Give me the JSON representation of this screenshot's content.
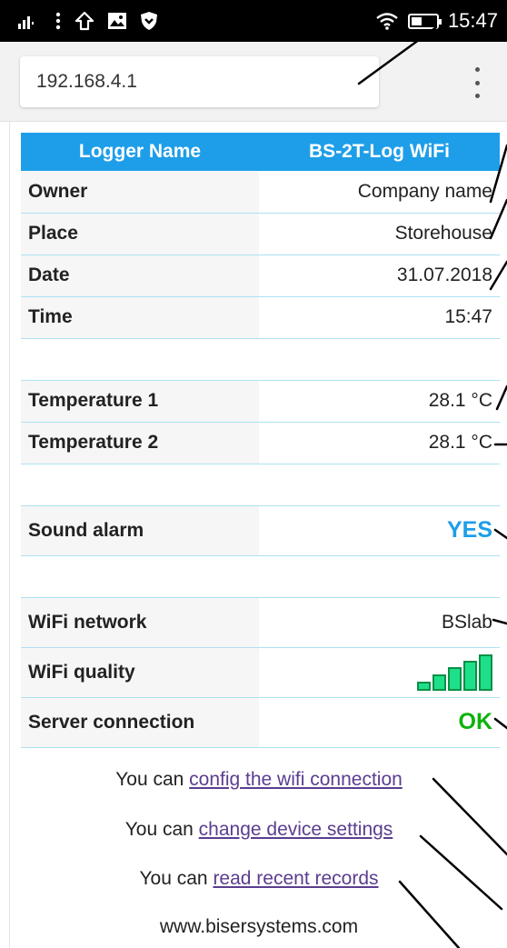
{
  "statusbar": {
    "time": "15:47"
  },
  "browser": {
    "url": "192.168.4.1"
  },
  "table": {
    "header": {
      "left": "Logger Name",
      "right": "BS-2T-Log WiFi"
    },
    "owner": {
      "label": "Owner",
      "value": "Company name"
    },
    "place": {
      "label": "Place",
      "value": "Storehouse"
    },
    "date": {
      "label": "Date",
      "value": "31.07.2018"
    },
    "time": {
      "label": "Time",
      "value": "15:47"
    },
    "temp1": {
      "label": "Temperature 1",
      "value": "28.1 °C"
    },
    "temp2": {
      "label": "Temperature 2",
      "value": "28.1 °C"
    },
    "sound": {
      "label": "Sound alarm",
      "value": "YES"
    },
    "wifi_network": {
      "label": "WiFi network",
      "value": "BSlab"
    },
    "wifi_quality": {
      "label": "WiFi quality",
      "bars": 5,
      "max_bars": 5
    },
    "server": {
      "label": "Server connection",
      "value": "OK"
    }
  },
  "links": [
    {
      "prefix": "You can ",
      "text": "config the wifi connection"
    },
    {
      "prefix": "You can ",
      "text": "change device settings"
    },
    {
      "prefix": "You can ",
      "text": "read recent records"
    }
  ],
  "footer": "www.bisersystems.com",
  "colors": {
    "header_bg": "#1e9ee8",
    "yes": "#1e9ee8",
    "ok": "#0cb30c",
    "signal": "#1fe08a",
    "link": "#5b3d8f"
  },
  "icons": [
    "signal-icon",
    "menu-icon",
    "upload-icon",
    "image-icon",
    "shield-icon",
    "wifi-icon",
    "battery-icon",
    "overflow-menu-icon"
  ]
}
